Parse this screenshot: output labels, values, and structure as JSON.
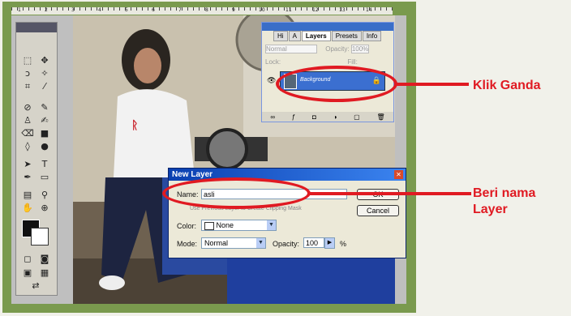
{
  "layers_panel": {
    "tabs": [
      "Hi",
      "A",
      "Layers",
      "Presets",
      "Info"
    ],
    "blend_mode": "Normal",
    "opacity_label": "Opacity:",
    "opacity_value": "100%",
    "lock_label": "Lock:",
    "fill_label": "Fill:",
    "layer_name": "Background"
  },
  "dialog": {
    "title": "New Layer",
    "name_label": "Name:",
    "name_value": "asli",
    "ok_label": "OK",
    "cancel_label": "Cancel",
    "group_option": "Use Previous Layer to Create Clipping Mask",
    "color_label": "Color:",
    "color_value": "None",
    "mode_label": "Mode:",
    "mode_value": "Normal",
    "opacity_label": "Opacity:",
    "opacity_value": "100",
    "opacity_unit": "%"
  },
  "callouts": {
    "double_click": "Klik Ganda",
    "name_layer_line1": "Beri nama",
    "name_layer_line2": "Layer"
  },
  "ruler_numbers": [
    "1",
    "2",
    "3",
    "4",
    "5",
    "6",
    "7",
    "8",
    "9",
    "10",
    "11",
    "12",
    "13",
    "14"
  ],
  "colors": {
    "annotation": "#e01a22",
    "frame": "#7a9a4e",
    "selection": "#3b6fd0"
  }
}
